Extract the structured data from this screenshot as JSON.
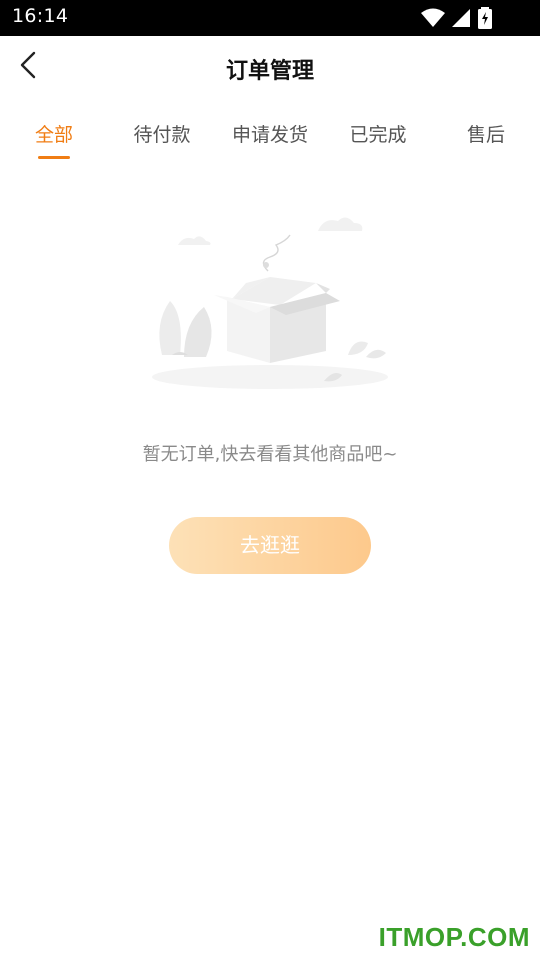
{
  "status_bar": {
    "time": "16:14"
  },
  "nav": {
    "title": "订单管理"
  },
  "tabs": [
    {
      "label": "全部",
      "active": true
    },
    {
      "label": "待付款",
      "active": false
    },
    {
      "label": "申请发货",
      "active": false
    },
    {
      "label": "已完成",
      "active": false
    },
    {
      "label": "售后",
      "active": false
    }
  ],
  "empty_state": {
    "message": "暂无订单,快去看看其他商品吧~",
    "button_label": "去逛逛"
  },
  "watermark": "ITMOP.COM",
  "colors": {
    "accent": "#f07d14",
    "button_gradient_start": "#fde1b7",
    "button_gradient_end": "#fdc98c",
    "watermark": "#3aa02a"
  }
}
